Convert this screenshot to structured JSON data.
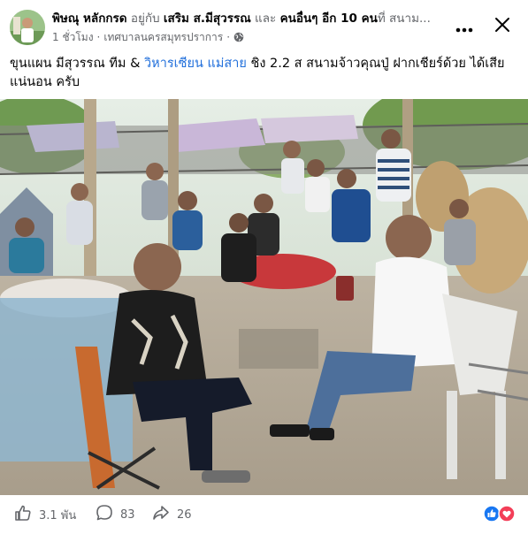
{
  "post": {
    "author_prefix": "พิษณุ หลักกรด",
    "with_text": "อยู่กับ",
    "tagged": "เสริม ส.มีสุวรรณ",
    "and_text": "และ",
    "others": "คนอื่นๆ อีก 10 คน",
    "at_text": "ที่ สนาม...",
    "time": "1 ชั่วโมง",
    "location": "เทศบาลนครสมุทรปราการ",
    "caption_part1": "ขุนแผน มีสุวรรณ ทีม & ",
    "caption_link": "วิหารเซียน แม่สาย",
    "caption_part2": " ชิง 2.2 ส สนามจ้าวคุณปู่  ฝากเชียร์ด้วย ได้เสีย แน่นอน ครับ"
  },
  "footer": {
    "likes": "3.1 พัน",
    "comments": "83",
    "shares": "26"
  },
  "icons": {
    "more": "more-icon",
    "close": "close-icon",
    "globe": "globe-icon",
    "like": "thumbs-up-icon",
    "comment": "comment-icon",
    "share": "share-icon"
  },
  "colors": {
    "link": "#216fdb",
    "muted": "#65676b",
    "like_blue": "#1877f2",
    "love_red": "#f33e58"
  }
}
